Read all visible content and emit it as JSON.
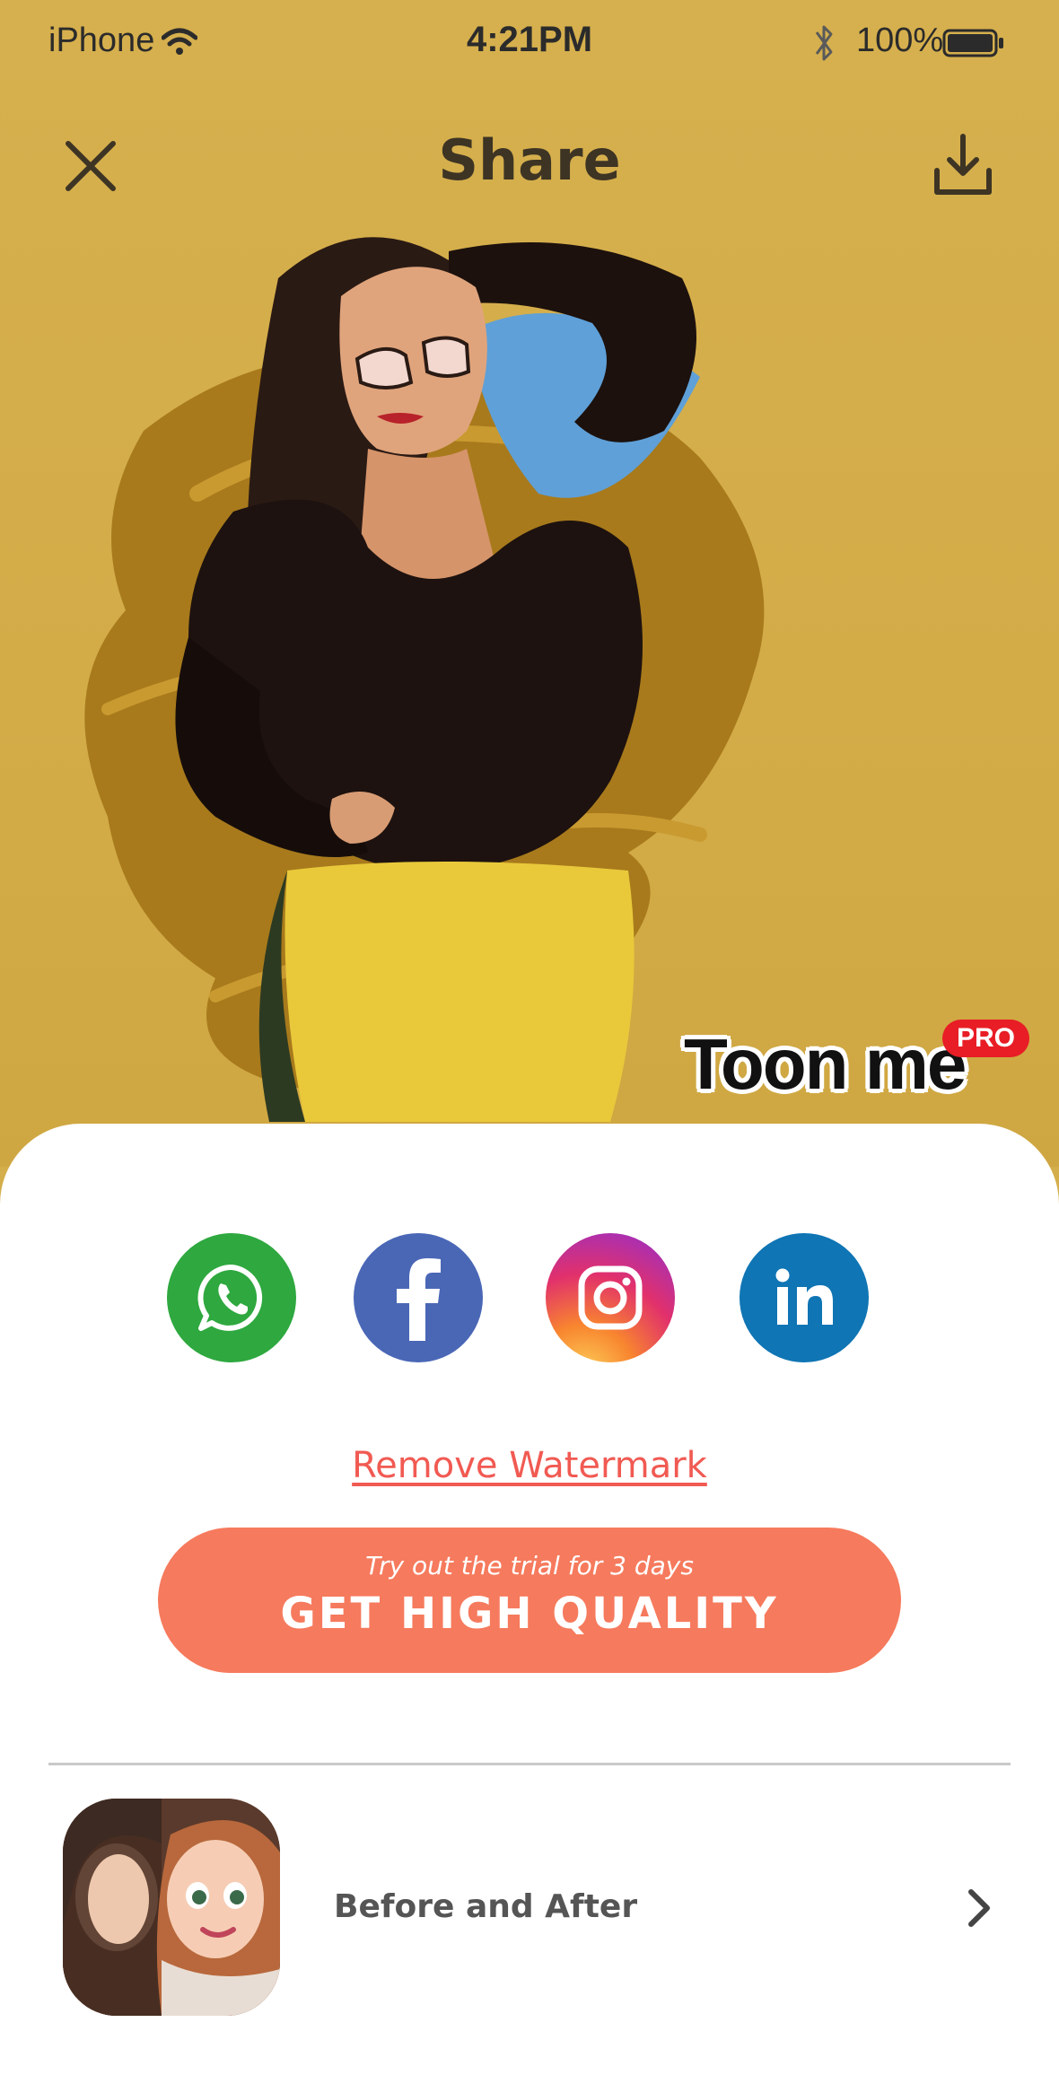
{
  "status_bar": {
    "carrier": "iPhone",
    "time": "4:21PM",
    "battery": "100%"
  },
  "nav": {
    "title": "Share",
    "close_icon": "close-icon",
    "download_icon": "download-icon"
  },
  "artwork": {
    "watermark_text": "Toon me",
    "pro_badge": "PRO"
  },
  "share_targets": [
    {
      "name": "WhatsApp",
      "icon": "whatsapp-icon",
      "color": "#2ea83f"
    },
    {
      "name": "Facebook",
      "icon": "facebook-icon",
      "color": "#4a67b6"
    },
    {
      "name": "Instagram",
      "icon": "instagram-icon",
      "color": "#e1306c"
    },
    {
      "name": "LinkedIn",
      "icon": "linkedin-icon",
      "color": "#0f75b4"
    }
  ],
  "remove_watermark_label": "Remove Watermark",
  "cta": {
    "subtitle": "Try out the trial for 3 days",
    "label": "GET HIGH QUALITY",
    "color": "#f67a5d"
  },
  "before_after": {
    "label": "Before and After",
    "chevron_icon": "chevron-right-icon"
  },
  "colors": {
    "background": "#d4ae4a",
    "link": "#f15a52"
  }
}
